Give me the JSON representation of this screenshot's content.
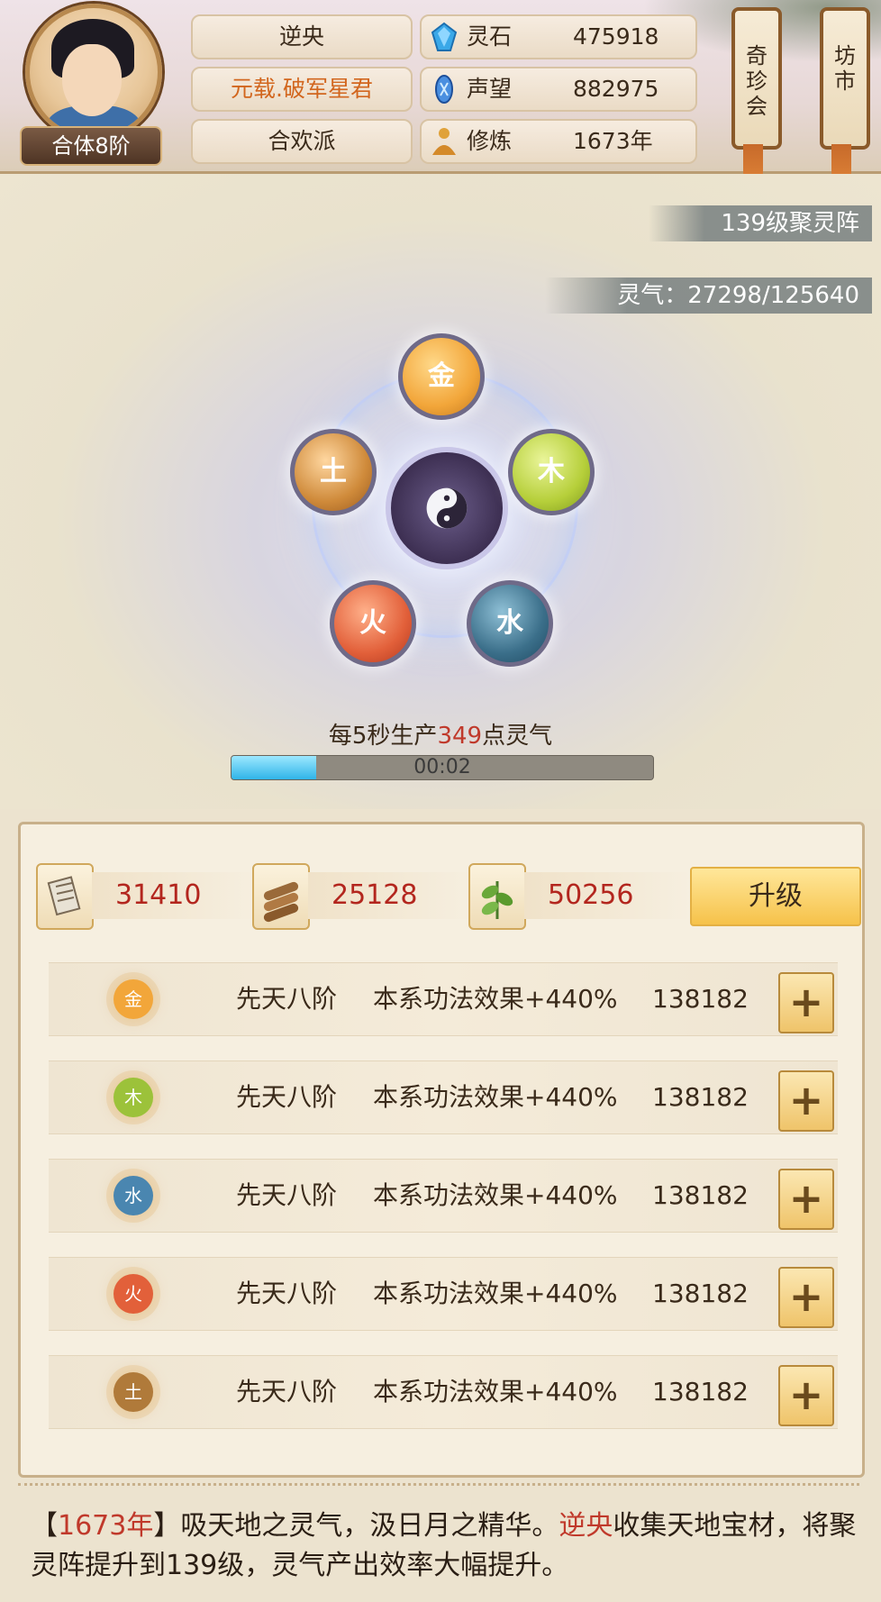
{
  "player": {
    "realm_badge": "合体8阶",
    "name": "逆央",
    "title": "元载.破军星君",
    "sect": "合欢派"
  },
  "stats": [
    {
      "label": "灵石",
      "value": "475918",
      "icon": "spirit-stone-icon"
    },
    {
      "label": "声望",
      "value": "882975",
      "icon": "prestige-icon"
    },
    {
      "label": "修炼",
      "value": "1673年",
      "icon": "meditation-icon"
    }
  ],
  "shortcuts": [
    {
      "label": "奇珍会"
    },
    {
      "label": "坊市"
    }
  ],
  "array": {
    "level_label": "139级聚灵阵",
    "qi_label": "灵气：27298/125640",
    "elements": [
      "金",
      "木",
      "水",
      "火",
      "土"
    ],
    "rate_prefix": "每5秒生产",
    "rate_value": "349",
    "rate_suffix": "点灵气",
    "timer": "00:02",
    "progress": 0.2
  },
  "resources": [
    {
      "icon": "scroll-icon",
      "value": "31410"
    },
    {
      "icon": "wood-icon",
      "value": "25128"
    },
    {
      "icon": "herb-icon",
      "value": "50256"
    }
  ],
  "upgrade_label": "升级",
  "element_rows": [
    {
      "element": "金",
      "level": "先天八阶",
      "effect": "本系功法效果+440%",
      "cost": "138182"
    },
    {
      "element": "木",
      "level": "先天八阶",
      "effect": "本系功法效果+440%",
      "cost": "138182"
    },
    {
      "element": "水",
      "level": "先天八阶",
      "effect": "本系功法效果+440%",
      "cost": "138182"
    },
    {
      "element": "火",
      "level": "先天八阶",
      "effect": "本系功法效果+440%",
      "cost": "138182"
    },
    {
      "element": "土",
      "level": "先天八阶",
      "effect": "本系功法效果+440%",
      "cost": "138182"
    }
  ],
  "plus_label": "+",
  "log": {
    "bracket_open": "【",
    "year": "1673年",
    "bracket_close": "】",
    "text1": "吸天地之灵气，汲日月之精华。",
    "name": "逆央",
    "text2": "收集天地宝材，将聚灵阵提升到139级，灵气产出效率大幅提升。"
  },
  "colors": {
    "gold": "#f2a63a",
    "wood": "#b6cf3a",
    "water": "#3b6f8a",
    "fire": "#e2603a",
    "earth": "#cf8a3a",
    "accent_red": "#c0392b"
  }
}
